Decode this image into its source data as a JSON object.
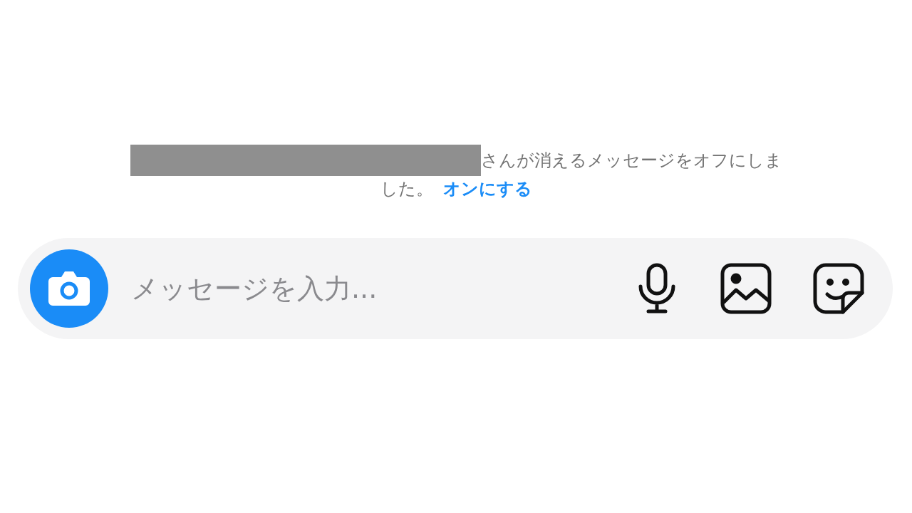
{
  "notice": {
    "lines": [
      "さんが消えるメッセージをオフにしま",
      "した。"
    ],
    "link": "オンにする"
  },
  "composer": {
    "placeholder": "メッセージを入力..."
  }
}
